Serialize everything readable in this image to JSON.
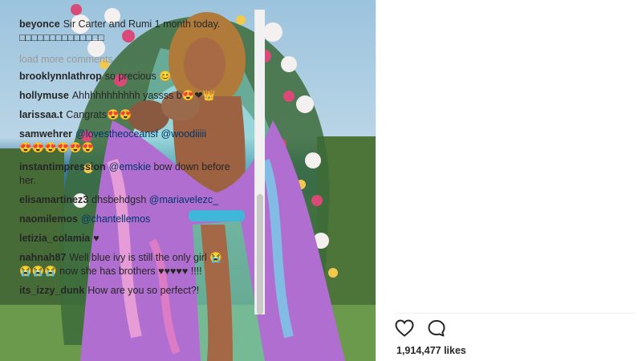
{
  "post": {
    "image_alt": "Woman in flowing floral gown holding two newborns in front of a flower arch by the sea",
    "caption_user": "beyonce",
    "caption_text": "Sir Carter and Rumi 1 month today. □□□□□□□□□□□□□□",
    "load_more": "load more comments",
    "likes": "1,914,477 likes"
  },
  "comments": [
    {
      "user": "brooklynnlathrop",
      "text": "so precious 😊"
    },
    {
      "user": "hollymuse",
      "text": "Ahhhhhhhhhhh yassss b😍❤👑"
    },
    {
      "user": "larissaa.t",
      "text": "Cangrats😍😍"
    },
    {
      "user": "samwehrer",
      "mentions": [
        "@lovestheoceansf",
        "@woodiiiii"
      ],
      "text": "😍😍😍😍😍😍"
    },
    {
      "user": "instantimpression",
      "mentions": [
        "@emskie"
      ],
      "text": "bow down before her."
    },
    {
      "user": "elisamartinez3",
      "text": "dhsbehdgsh",
      "mentions": [
        "@mariavelezc_"
      ]
    },
    {
      "user": "naomilemos",
      "mentions": [
        "@chantellemos"
      ]
    },
    {
      "user": "letizia_colamia",
      "text": "♥"
    },
    {
      "user": "nahnah87",
      "text": "Well blue ivy is still the only girl 😭😭😭😭 now she has brothers ♥♥♥♥♥ !!!!"
    },
    {
      "user": "its_izzy_dunk",
      "text": "How are you so perfect?!"
    }
  ],
  "icons": {
    "like": "heart-outline-icon",
    "comment": "speech-bubble-icon"
  },
  "colors": {
    "mention": "#003569",
    "muted": "#999999",
    "text": "#262626"
  }
}
